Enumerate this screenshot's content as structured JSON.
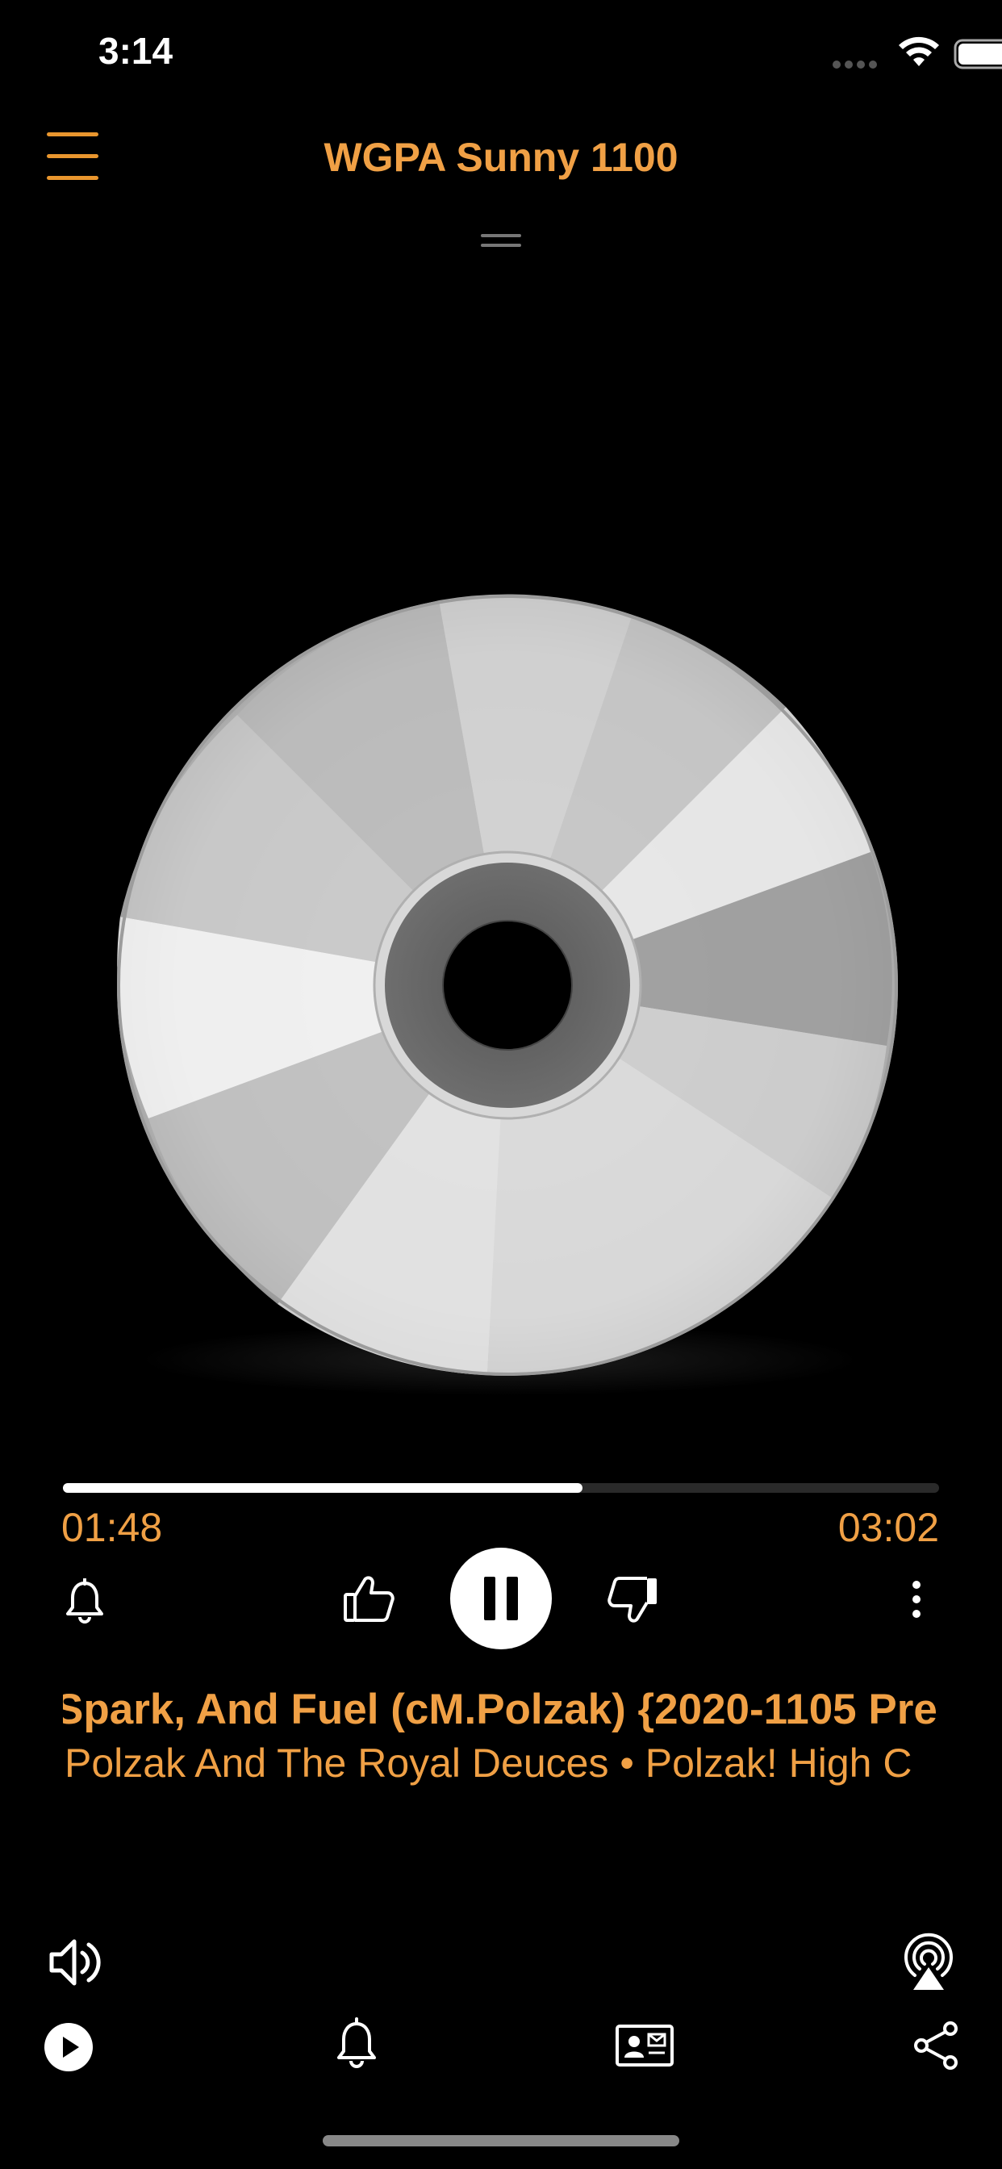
{
  "status_bar": {
    "time": "3:14"
  },
  "header": {
    "station_title": "WGPA Sunny 1100"
  },
  "player": {
    "elapsed": "01:48",
    "total": "03:02",
    "progress_fraction": 0.593,
    "state": "playing"
  },
  "track": {
    "title": "Spark, And Fuel (cM.Polzak) {2020-1105 Pre",
    "subtitle": "Polzak And The Royal Deuces • Polzak! High C"
  },
  "colors": {
    "accent": "#f0a045",
    "background": "#000000"
  },
  "icons": {
    "menu": "menu-icon",
    "alarm": "bell-icon",
    "like": "thumbs-up-icon",
    "pause": "pause-icon",
    "dislike": "thumbs-down-icon",
    "more": "more-vertical-icon",
    "volume": "volume-icon",
    "airplay": "airplay-icon",
    "play": "play-icon",
    "notifications": "bell-icon",
    "contact": "contact-card-icon",
    "share": "share-icon"
  }
}
